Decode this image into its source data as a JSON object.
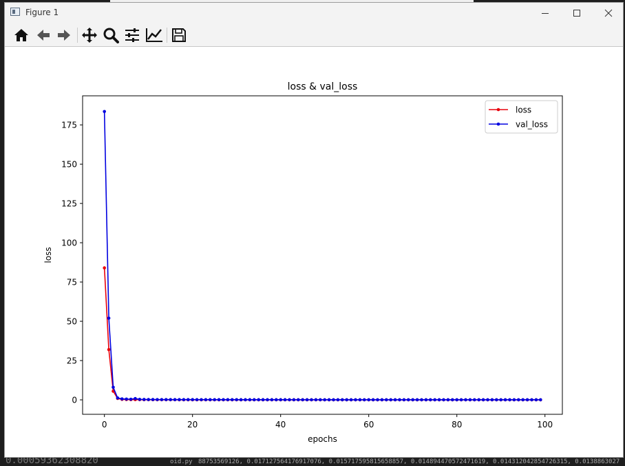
{
  "window": {
    "title": "Figure 1"
  },
  "toolbar": {
    "buttons": [
      "home-icon",
      "back-arrow-icon",
      "forward-arrow-icon",
      "pan-icon",
      "zoom-icon",
      "subplots-icon",
      "axes-icon",
      "save-icon"
    ]
  },
  "background": {
    "bottom_number": "0.00059362308820",
    "bottom_file": "oid.py",
    "bottom_numbers": "88753569126, 0.017127564176917076, 0.015717595815658857, 0.014894470572471619, 0.014312042854726315, 0.0138863027"
  },
  "chart_data": {
    "type": "line",
    "title": "loss & val_loss",
    "xlabel": "epochs",
    "ylabel": "loss",
    "xlim": [
      -4.95,
      103.95
    ],
    "ylim": [
      -9.2,
      193.5
    ],
    "xticks": [
      0,
      20,
      40,
      60,
      80,
      100
    ],
    "yticks": [
      0,
      25,
      50,
      75,
      100,
      125,
      150,
      175
    ],
    "legend_position": "upper right",
    "grid": false,
    "series": [
      {
        "name": "loss",
        "color": "#e8000b",
        "values": [
          84.0,
          32.0,
          5.5,
          0.9,
          0.3,
          0.2,
          0.15,
          0.12,
          0.1,
          0.09,
          0.08,
          0.07,
          0.06,
          0.06,
          0.05,
          0.05,
          0.05,
          0.04,
          0.04,
          0.04,
          0.04,
          0.035,
          0.035,
          0.033,
          0.032,
          0.031,
          0.03,
          0.029,
          0.028,
          0.028,
          0.027,
          0.026,
          0.026,
          0.025,
          0.025,
          0.024,
          0.024,
          0.023,
          0.023,
          0.022,
          0.022,
          0.022,
          0.021,
          0.021,
          0.021,
          0.02,
          0.02,
          0.02,
          0.02,
          0.019,
          0.019,
          0.019,
          0.019,
          0.018,
          0.018,
          0.018,
          0.018,
          0.018,
          0.017,
          0.017,
          0.017,
          0.017,
          0.017,
          0.017,
          0.016,
          0.016,
          0.016,
          0.016,
          0.016,
          0.016,
          0.016,
          0.015,
          0.015,
          0.015,
          0.015,
          0.015,
          0.015,
          0.015,
          0.015,
          0.015,
          0.014,
          0.014,
          0.014,
          0.014,
          0.014,
          0.014,
          0.014,
          0.014,
          0.014,
          0.014,
          0.014,
          0.014,
          0.014,
          0.014,
          0.014,
          0.014,
          0.014,
          0.014,
          0.014,
          0.014
        ]
      },
      {
        "name": "val_loss",
        "color": "#0000e0",
        "values": [
          183.5,
          52.0,
          8.0,
          1.2,
          0.6,
          0.5,
          0.4,
          0.8,
          0.3,
          0.25,
          0.2,
          0.2,
          0.18,
          0.17,
          0.16,
          0.15,
          0.15,
          0.14,
          0.14,
          0.13,
          0.13,
          0.12,
          0.12,
          0.12,
          0.11,
          0.11,
          0.11,
          0.1,
          0.1,
          0.1,
          0.1,
          0.09,
          0.09,
          0.09,
          0.09,
          0.09,
          0.08,
          0.08,
          0.08,
          0.08,
          0.08,
          0.08,
          0.07,
          0.07,
          0.07,
          0.07,
          0.07,
          0.07,
          0.07,
          0.07,
          0.06,
          0.06,
          0.06,
          0.06,
          0.06,
          0.06,
          0.06,
          0.06,
          0.06,
          0.06,
          0.06,
          0.05,
          0.05,
          0.05,
          0.05,
          0.05,
          0.05,
          0.05,
          0.05,
          0.05,
          0.05,
          0.05,
          0.05,
          0.05,
          0.05,
          0.05,
          0.05,
          0.05,
          0.05,
          0.05,
          0.05,
          0.05,
          0.05,
          0.05,
          0.05,
          0.05,
          0.05,
          0.05,
          0.05,
          0.05,
          0.05,
          0.05,
          0.05,
          0.05,
          0.05,
          0.05,
          0.05,
          0.05,
          0.05,
          0.05
        ]
      }
    ]
  }
}
